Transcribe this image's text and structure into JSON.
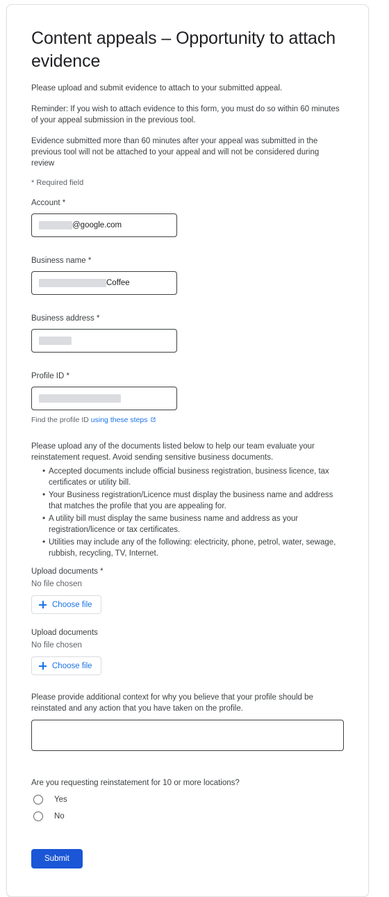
{
  "form": {
    "title": "Content appeals – Opportunity to attach evidence",
    "intro": "Please upload and submit evidence to attach to your submitted appeal.",
    "reminder": "Reminder: If you wish to attach evidence to this form, you must do so within 60 minutes of your appeal submission in the previous tool.",
    "warning": "Evidence submitted more than 60 minutes after your appeal was submitted in the previous tool will not be attached to your appeal and will not be considered during review",
    "required_note": "* Required field"
  },
  "fields": {
    "account": {
      "label": "Account *",
      "value_suffix": "@google.com",
      "redacted": true
    },
    "business_name": {
      "label": "Business name  *",
      "value_suffix": "Coffee",
      "redacted": true
    },
    "business_address": {
      "label": "Business address *",
      "value_suffix": "",
      "redacted": true
    },
    "profile_id": {
      "label": "Profile ID *",
      "value_suffix": "",
      "redacted": true,
      "helper_prefix": "Find the profile ID ",
      "helper_link": "using these steps",
      "helper_icon": "external-link-icon"
    }
  },
  "documents": {
    "intro": "Please upload any of the documents listed below to help our team evaluate your reinstatement request. Avoid sending sensitive business documents.",
    "bullets": [
      "Accepted documents include official business registration, business licence, tax certificates or utility bill.",
      "Your Business registration/Licence must display the business name and address that matches the profile that you are appealing for.",
      "A utility bill must display the same business name and address as your registration/licence or tax certificates.",
      "Utilities may include any of the following: electricity, phone, petrol, water, sewage, rubbish, recycling, TV, Internet."
    ]
  },
  "uploads": [
    {
      "label": "Upload documents *",
      "status": "No file chosen",
      "button_label": "Choose file",
      "button_icon": "plus-icon"
    },
    {
      "label": "Upload documents",
      "status": "No file chosen",
      "button_label": "Choose file",
      "button_icon": "plus-icon"
    }
  ],
  "context": {
    "label": "Please provide additional context for why you believe that your profile should be reinstated and any action that you have taken on the profile.",
    "value": "",
    "placeholder": ""
  },
  "locations_question": {
    "label": "Are you requesting reinstatement for 10 or more locations?",
    "options": [
      {
        "label": "Yes",
        "selected": false
      },
      {
        "label": "No",
        "selected": false
      }
    ]
  },
  "submit": {
    "label": "Submit"
  },
  "colors": {
    "accent_blue": "#1a73e8",
    "submit_blue": "#1a56d6",
    "text_primary": "#202124",
    "text_secondary": "#3c4043",
    "text_muted": "#5f6368",
    "border": "#3c4043",
    "redaction": "#dadce0"
  }
}
